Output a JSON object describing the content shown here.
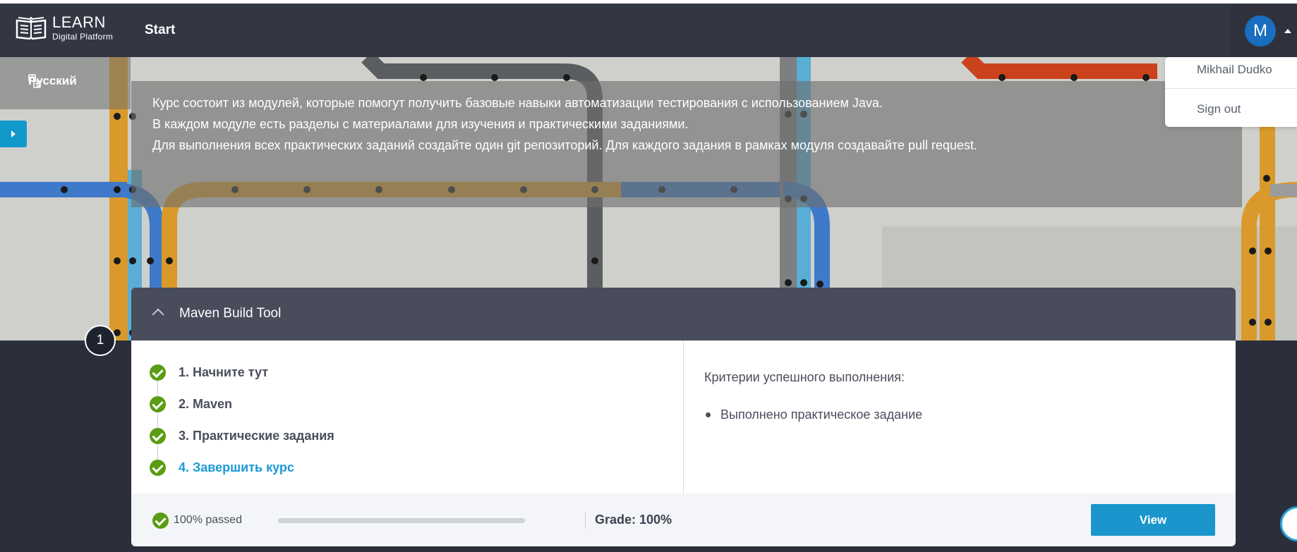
{
  "header": {
    "logo_title": "LEARN",
    "logo_subtitle": "Digital Platform",
    "nav_start": "Start",
    "avatar_initial": "M"
  },
  "user_menu": {
    "name": "Mikhail Dudko",
    "sign_out": "Sign out"
  },
  "hero": {
    "language": "Русский",
    "description": [
      "Курс состоит из модулей, которые помогут получить базовые навыки автоматизации тестирования с использованием Java.",
      "В каждом модуле есть разделы с материалами для изучения и практическими заданиями.",
      "Для выполнения всех практических заданий создайте один git репозиторий. Для каждого задания в рамках модуля создавайте pull request."
    ]
  },
  "module": {
    "number": "1",
    "title": "Maven Build Tool",
    "steps": [
      {
        "label": "1. Начните тут",
        "status": "completed"
      },
      {
        "label": "2. Maven",
        "status": "completed"
      },
      {
        "label": "3. Практические задания",
        "status": "completed"
      },
      {
        "label": "4. Завершить курс",
        "status": "completed",
        "active": true
      }
    ],
    "criteria_title": "Критерии успешного выполнения:",
    "criteria": [
      "Выполнено практическое задание"
    ],
    "passed_text": "100% passed",
    "progress": 1.0,
    "grade": "Grade: 100%",
    "view_button": "View"
  },
  "colors": {
    "topbar": "#333744",
    "accent": "#1a96cc",
    "check_green": "#5a9c12",
    "card_header": "#484c5b"
  }
}
